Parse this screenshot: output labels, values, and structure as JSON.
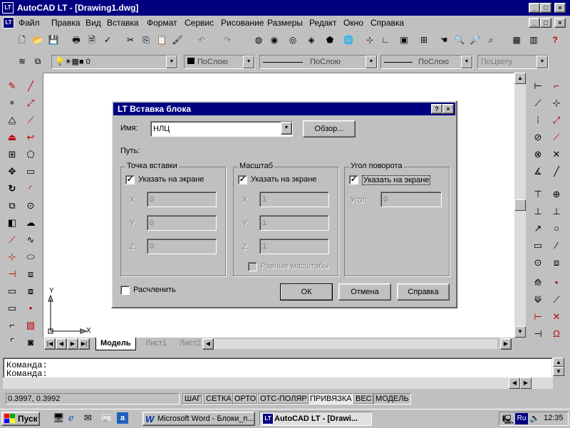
{
  "window": {
    "title": "AutoCAD LT - [Drawing1.dwg]",
    "logo": "LT",
    "controls": [
      "_",
      "□",
      "×"
    ]
  },
  "menu": [
    "Файл",
    "Правка",
    "Вид",
    "Вставка",
    "Формат",
    "Сервис",
    "Рисование",
    "Размеры",
    "Редакт",
    "Окно",
    "Справка"
  ],
  "layer_bar": {
    "layer_value": "0",
    "color_value": "ПоСлою",
    "linetype_value": "ПоСлою",
    "lineweight_value": "ПоСлою",
    "plotstyle_value": "ПоЦвету"
  },
  "axes": {
    "x": "X",
    "y": "Y"
  },
  "tabs": {
    "model": "Модель",
    "sheet1": "Лист1",
    "sheet2": "Лист2"
  },
  "command": {
    "line1": "Команда:",
    "line2": "Команда:"
  },
  "status": {
    "coords": "0.3997, 0.3992",
    "snap": "ШАГ",
    "grid": "СЕТКА",
    "ortho": "ОРТО",
    "polar": "ОТС-ПОЛЯР",
    "osnap": "ПРИВЯЗКА",
    "lwt": "ВЕС",
    "model": "МОДЕЛЬ"
  },
  "taskbar": {
    "start": "Пуск",
    "task1": "Microsoft Word - Блоки_п...",
    "task2": "AutoCAD LT - [Drawi...",
    "lang": "Ru",
    "time": "12:35"
  },
  "dialog": {
    "title": "Вставка блока",
    "logo": "LT",
    "name_label": "Имя:",
    "name_value": "НЛЦ",
    "browse": "Обзор...",
    "path_label": "Путь:",
    "insert_point": {
      "legend": "Точка вставки",
      "checkbox": "Указать на экране",
      "checked": true,
      "x_label": "X:",
      "x_value": "0",
      "y_label": "Y:",
      "y_value": "0",
      "z_label": "Z:",
      "z_value": "0"
    },
    "scale": {
      "legend": "Масштаб",
      "checkbox": "Указать на экране",
      "checked": true,
      "x_label": "X:",
      "x_value": "1",
      "y_label": "Y:",
      "y_value": "1",
      "z_label": "Z:",
      "z_value": "1",
      "uniform": "Равные масштабы"
    },
    "rotation": {
      "legend": "Угол поворота",
      "checkbox": "Указать на экране",
      "checked": true,
      "angle_label": "Угол:",
      "angle_value": "0"
    },
    "explode": "Расчленить",
    "ok": "ОК",
    "cancel": "Отмена",
    "help": "Справка"
  }
}
